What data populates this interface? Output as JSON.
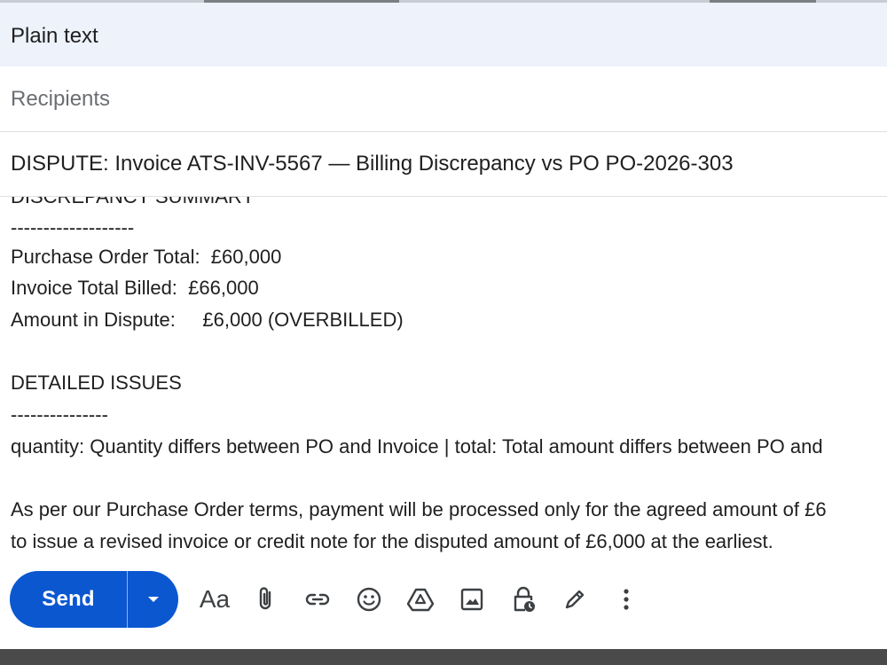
{
  "header": {
    "title": "Plain text"
  },
  "recipients": {
    "placeholder": "Recipients"
  },
  "subject": {
    "value": "DISPUTE: Invoice ATS-INV-5567 — Billing Discrepancy vs PO PO-2026-303"
  },
  "body": {
    "lines": [
      "DISCREPANCY SUMMARY",
      "-------------------",
      "Purchase Order Total:  £60,000",
      "Invoice Total Billed:  £66,000",
      "Amount in Dispute:     £6,000 (OVERBILLED)",
      "",
      "DETAILED ISSUES",
      "---------------",
      "quantity: Quantity differs between PO and Invoice | total: Total amount differs between PO and",
      "",
      "As per our Purchase Order terms, payment will be processed only for the agreed amount of £6",
      "to issue a revised invoice or credit note for the disputed amount of £6,000 at the earliest."
    ]
  },
  "footer": {
    "send_label": "Send",
    "format_label": "Aa",
    "icons": [
      "dropdown-arrow-icon",
      "attach-icon",
      "link-icon",
      "emoji-icon",
      "drive-icon",
      "photo-icon",
      "confidential-lock-icon",
      "signature-pen-icon",
      "more-options-icon"
    ]
  },
  "colors": {
    "accent": "#0b57d0",
    "header_bg": "#edf2fb",
    "text": "#1f1f1f",
    "placeholder": "#6b6f73"
  }
}
